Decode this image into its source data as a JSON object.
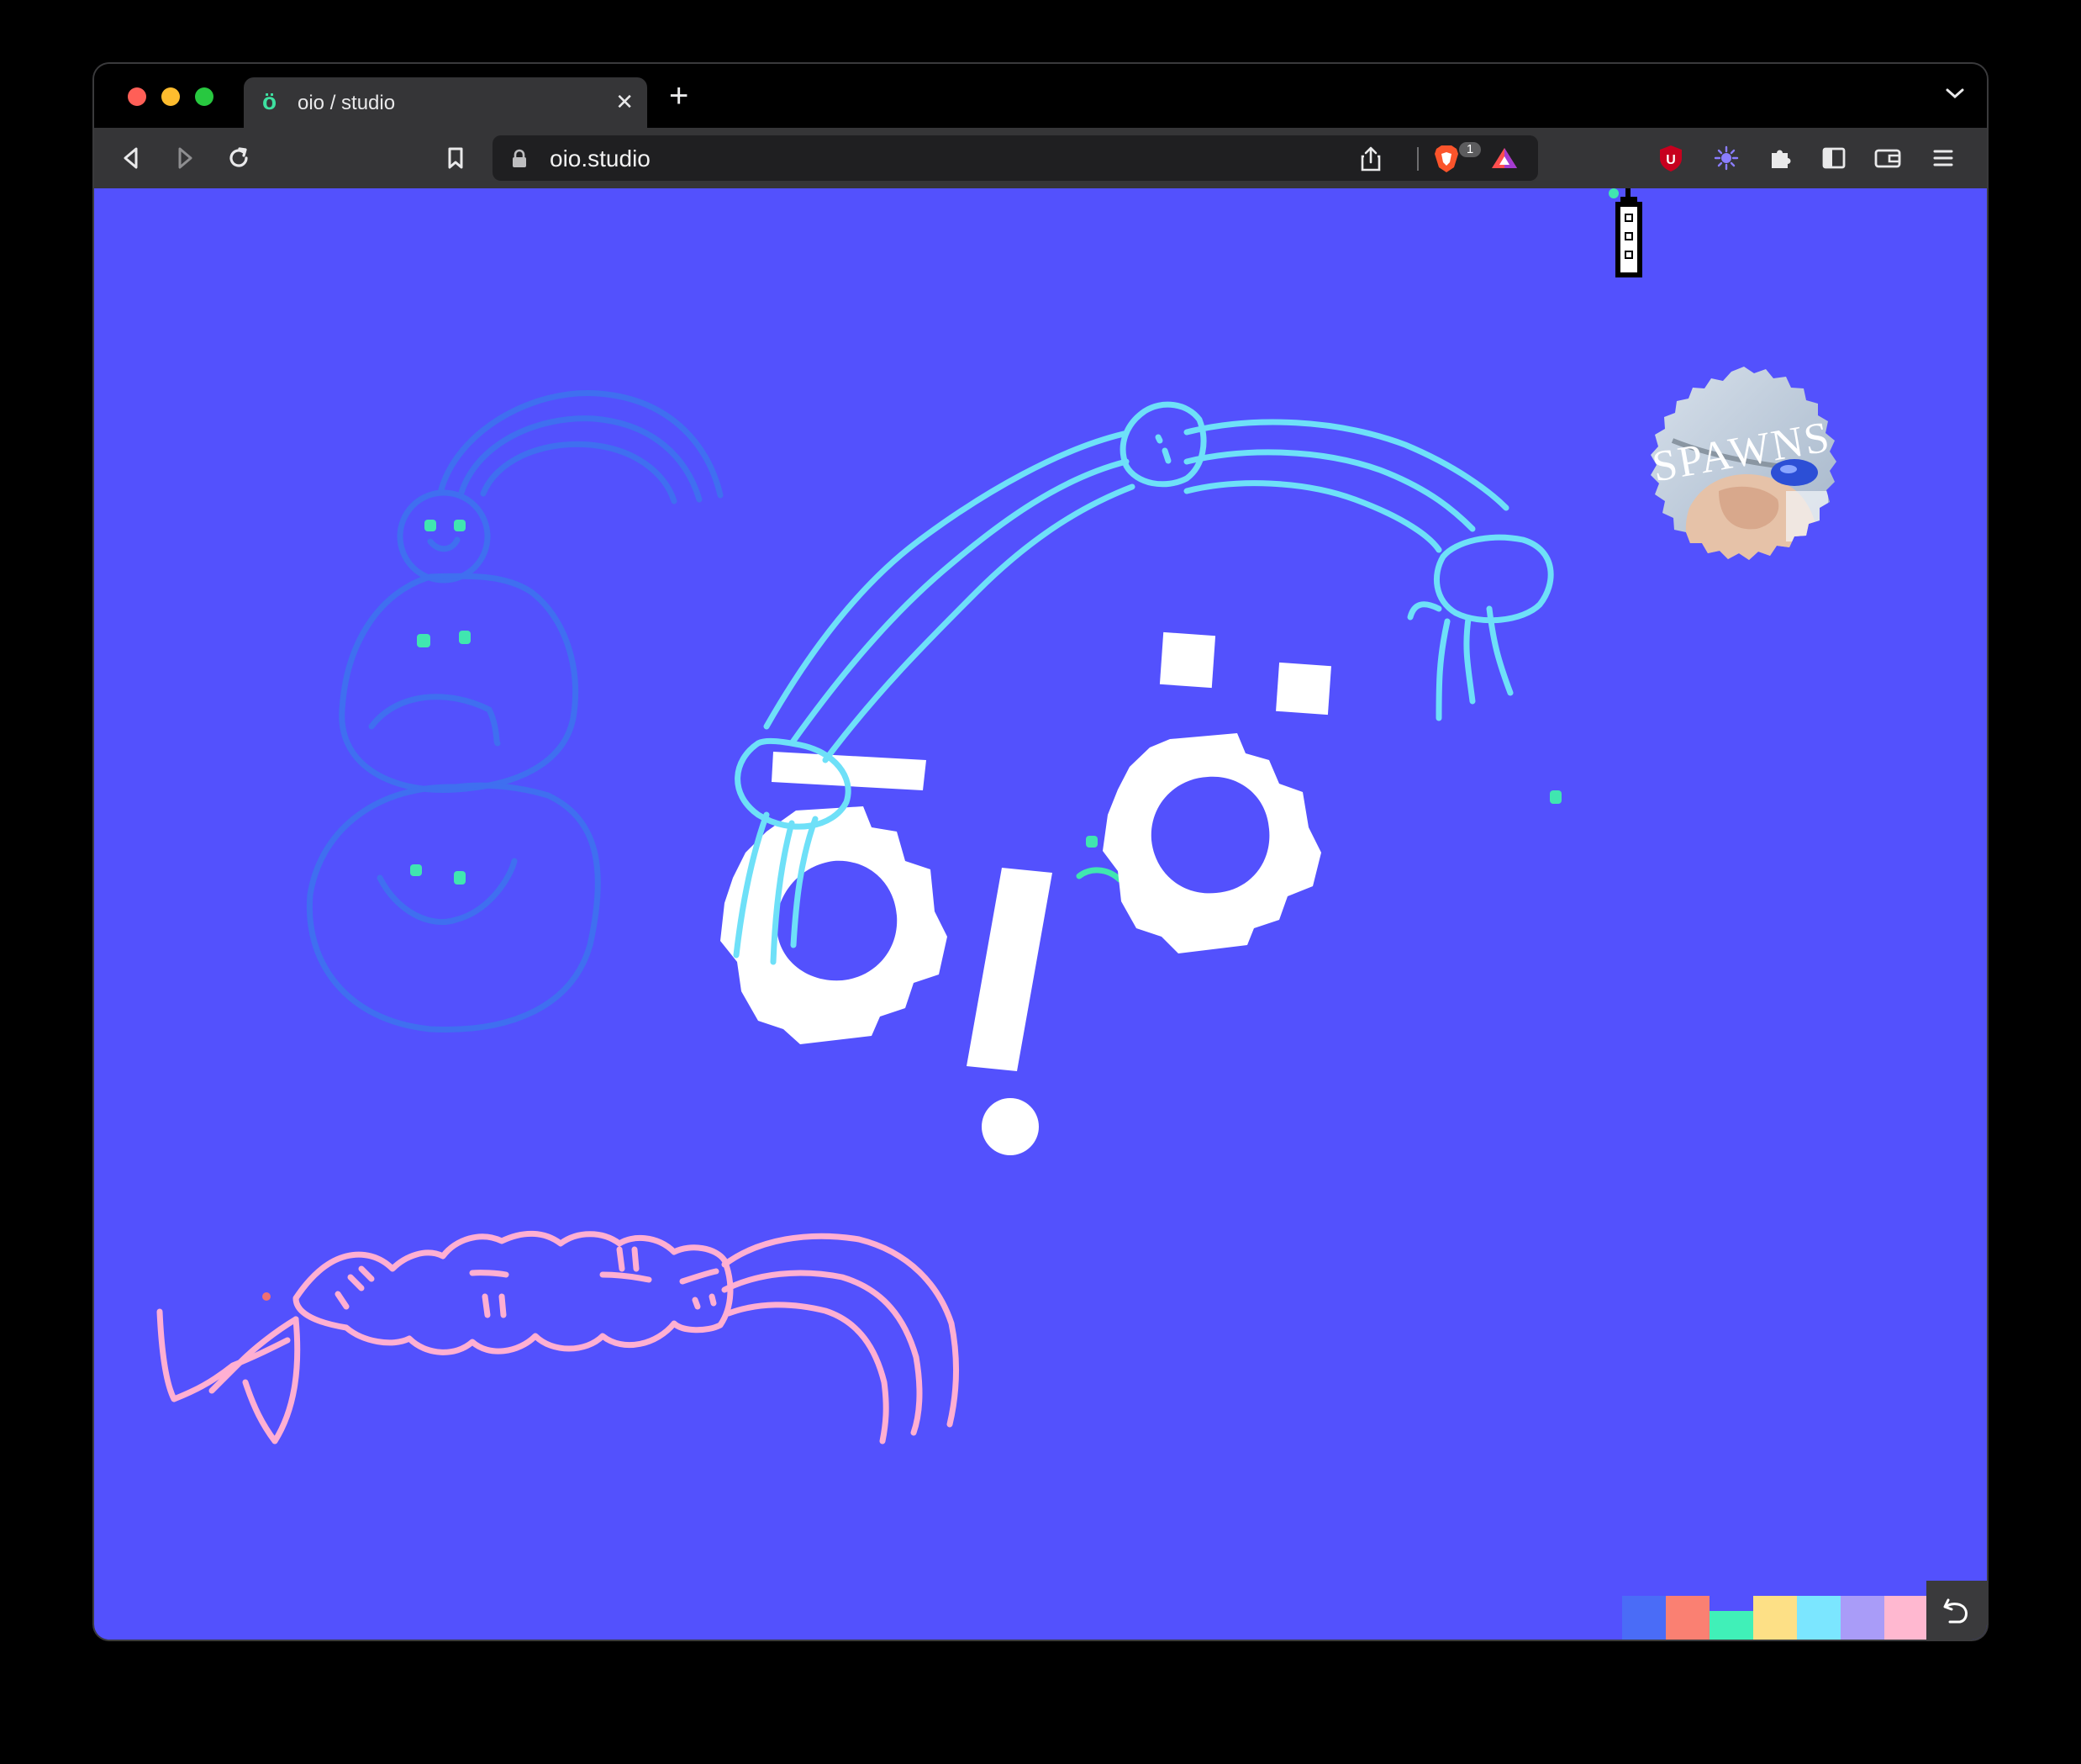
{
  "browser": {
    "tab": {
      "favicon_glyph": "ö",
      "title": "oio / studio",
      "close_glyph": "✕"
    },
    "new_tab_glyph": "+",
    "address_bar": {
      "url": "oio.studio",
      "shields_badge_count": "1"
    }
  },
  "canvas": {
    "background_color": "#5351fd",
    "sticker": {
      "text": "SPAWNS"
    },
    "palette": {
      "colors": [
        "#4a6cf7",
        "#fa8072",
        "#40f0b8",
        "#fde086",
        "#7be6ff",
        "#a99cf8",
        "#ffb8d0"
      ],
      "undo_icon": "undo-arrow-icon"
    },
    "drawing_colors": {
      "blue": "#3f6ff0",
      "cyan": "#6ee0f8",
      "pink": "#ffafd2",
      "green": "#40e6b0",
      "white": "#ffffff"
    }
  }
}
